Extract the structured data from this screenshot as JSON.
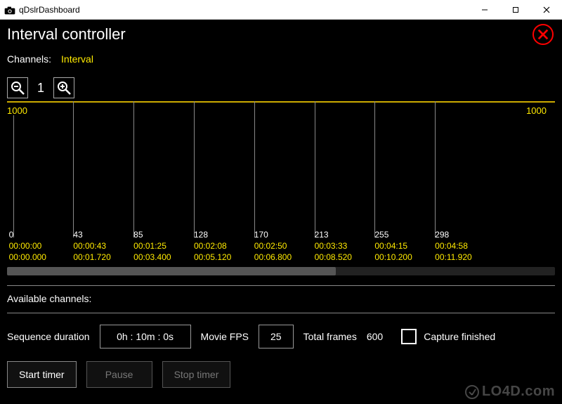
{
  "titlebar": {
    "app_title": "qDslrDashboard"
  },
  "header": {
    "title": "Interval controller"
  },
  "channels": {
    "label": "Channels:",
    "active": "Interval"
  },
  "zoom": {
    "value": "1"
  },
  "timeline": {
    "top_left": "1000",
    "top_right": "1000",
    "ticks": [
      {
        "x": 1.1,
        "frame": "0",
        "tc": "00:00:00",
        "sec": "00:00.000"
      },
      {
        "x": 12.1,
        "frame": "43",
        "tc": "00:00:43",
        "sec": "00:01.720"
      },
      {
        "x": 23.1,
        "frame": "85",
        "tc": "00:01:25",
        "sec": "00:03.400"
      },
      {
        "x": 34.1,
        "frame": "128",
        "tc": "00:02:08",
        "sec": "00:05.120"
      },
      {
        "x": 45.1,
        "frame": "170",
        "tc": "00:02:50",
        "sec": "00:06.800"
      },
      {
        "x": 56.1,
        "frame": "213",
        "tc": "00:03:33",
        "sec": "00:08.520"
      },
      {
        "x": 67.1,
        "frame": "255",
        "tc": "00:04:15",
        "sec": "00:10.200"
      },
      {
        "x": 78.1,
        "frame": "298",
        "tc": "00:04:58",
        "sec": "00:11.920"
      }
    ]
  },
  "available_label": "Available channels:",
  "controls": {
    "seq_dur_label": "Sequence duration",
    "seq_dur_value": "0h : 10m : 0s",
    "fps_label": "Movie FPS",
    "fps_value": "25",
    "total_frames_label": "Total frames",
    "total_frames_value": "600",
    "capture_label": "Capture finished"
  },
  "buttons": {
    "start": "Start timer",
    "pause": "Pause",
    "stop": "Stop timer"
  },
  "watermark": "LO4D.com"
}
